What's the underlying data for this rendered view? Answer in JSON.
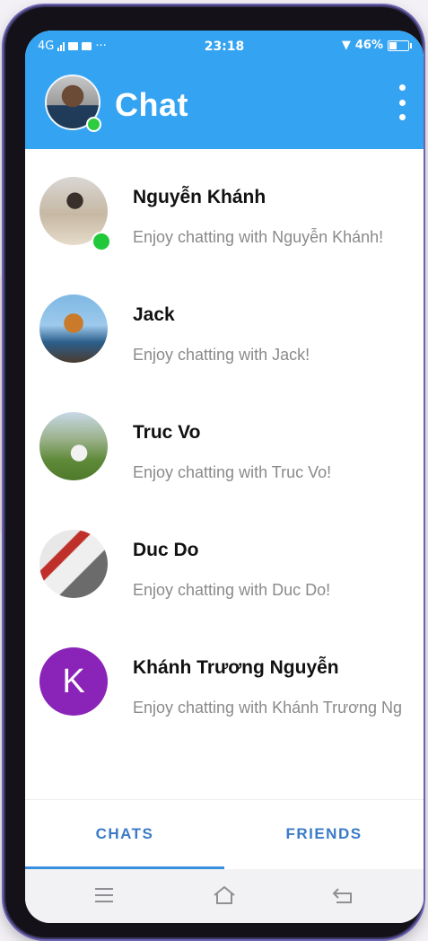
{
  "status_bar": {
    "network": "4G",
    "time": "23:18",
    "battery": "46%"
  },
  "app_bar": {
    "title": "Chat"
  },
  "chats": [
    {
      "name": "Nguyễn Khánh",
      "preview": "Enjoy chatting with Nguyễn Khánh!",
      "online": true
    },
    {
      "name": "Jack",
      "preview": "Enjoy chatting with Jack!",
      "online": false
    },
    {
      "name": "Truc Vo",
      "preview": "Enjoy chatting with Truc Vo!",
      "online": false
    },
    {
      "name": "Duc Do",
      "preview": "Enjoy chatting with Duc Do!",
      "online": false
    },
    {
      "name": "Khánh Trương Nguyễn",
      "preview": "Enjoy chatting with Khánh Trương Ng",
      "online": false,
      "initial": "K"
    }
  ],
  "tabs": [
    {
      "label": "CHATS",
      "active": true
    },
    {
      "label": "FRIENDS",
      "active": false
    }
  ],
  "colors": {
    "primary": "#34a3f2",
    "online": "#21c93a",
    "tab_text": "#3a7bc8",
    "letter_avatar": "#8a24b8"
  },
  "icons": {
    "signal": "signal-bars-icon",
    "wifi": "wifi-icon",
    "battery": "battery-icon",
    "overflow": "more-vertical-icon",
    "nav_menu": "menu-icon",
    "nav_home": "home-icon",
    "nav_back": "back-icon"
  }
}
